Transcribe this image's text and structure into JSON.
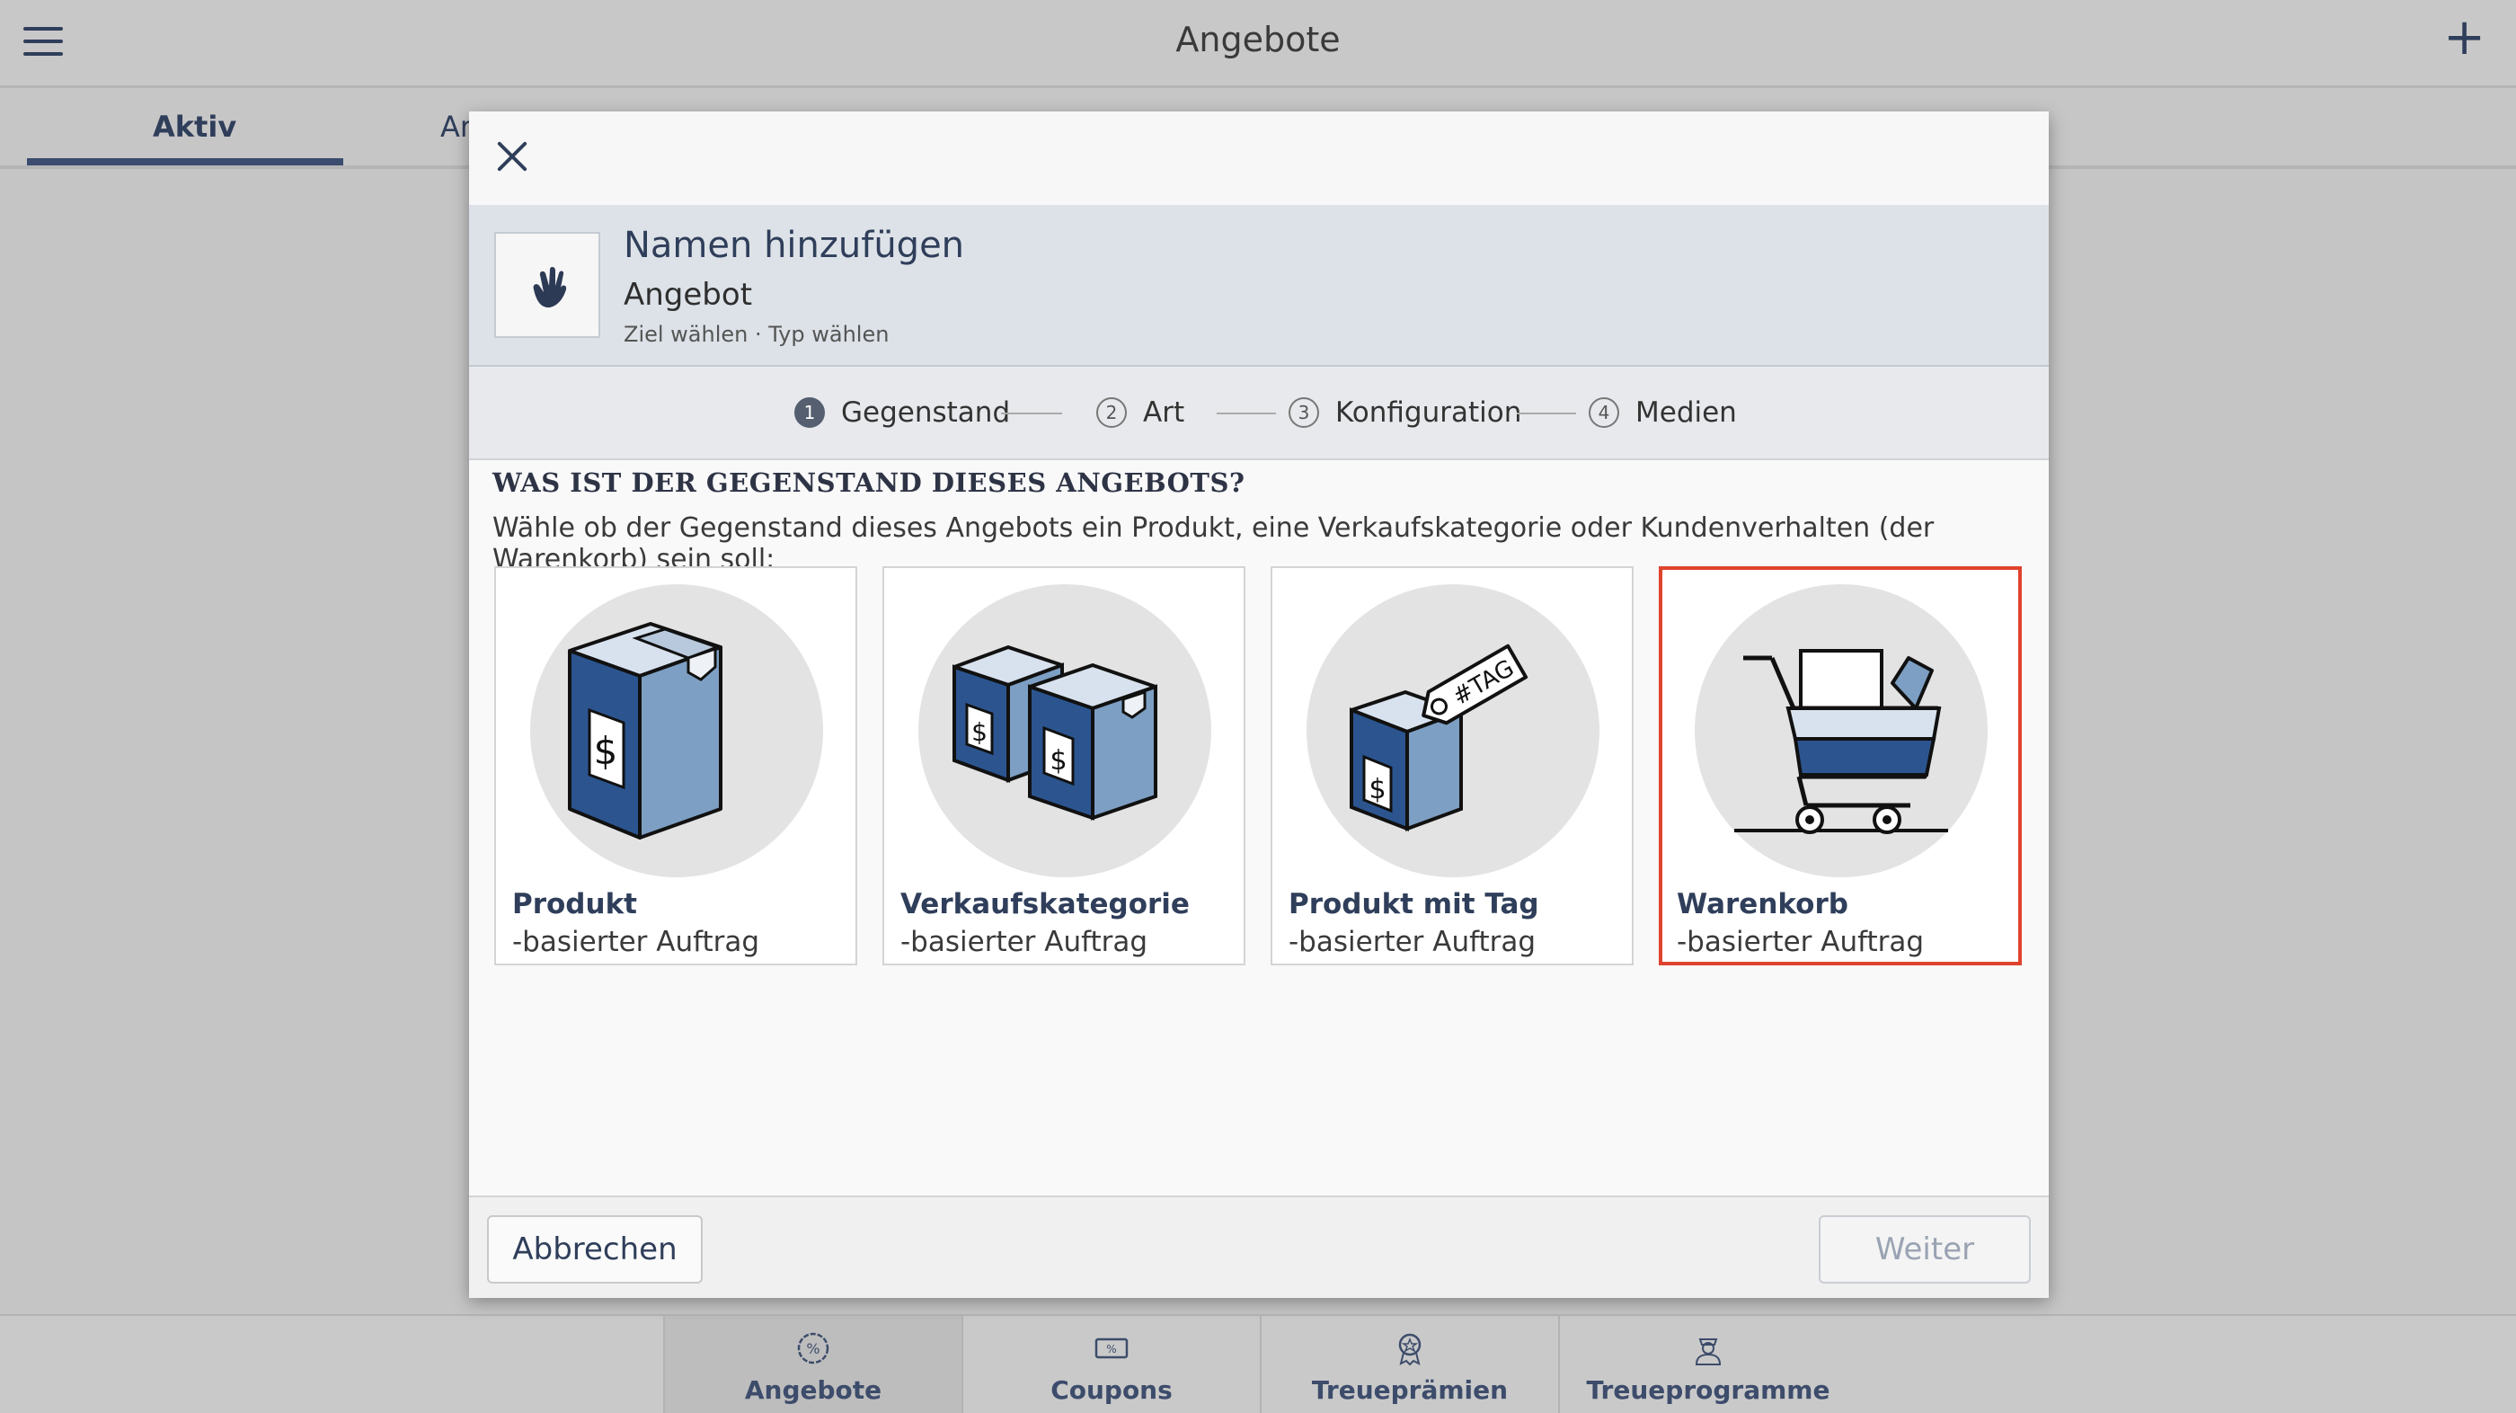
{
  "app": {
    "title": "Angebote",
    "tabs": [
      "Aktiv",
      "Ar"
    ]
  },
  "bottom_nav": [
    {
      "label": "Angebote",
      "icon": "percent-badge-icon"
    },
    {
      "label": "Coupons",
      "icon": "coupon-icon"
    },
    {
      "label": "Treueprämien",
      "icon": "award-icon"
    },
    {
      "label": "Treueprogramme",
      "icon": "person-badge-icon"
    }
  ],
  "modal": {
    "header": {
      "title": "Namen hinzufügen",
      "subtitle": "Angebot",
      "breadcrumb": "Ziel wählen · Typ wählen"
    },
    "steps": [
      {
        "num": "1",
        "label": "Gegenstand",
        "active": true
      },
      {
        "num": "2",
        "label": "Art",
        "active": false
      },
      {
        "num": "3",
        "label": "Konfiguration",
        "active": false
      },
      {
        "num": "4",
        "label": "Medien",
        "active": false
      }
    ],
    "question": "WAS IST DER GEGENSTAND DIESES ANGEBOTS?",
    "instruction": "Wähle ob der Gegenstand dieses Angebots ein Produkt, eine Verkaufskategorie oder Kundenverhalten (der Warenkorb) sein soll:",
    "options": [
      {
        "title": "Produkt",
        "subtitle": "-basierter Auftrag",
        "icon": "product-box-icon",
        "selected": false
      },
      {
        "title": "Verkaufskategorie",
        "subtitle": "-basierter Auftrag",
        "icon": "category-boxes-icon",
        "selected": false
      },
      {
        "title": "Produkt mit Tag",
        "subtitle": "-basierter Auftrag",
        "icon": "tagged-product-icon",
        "tag_text": "#TAG",
        "selected": false
      },
      {
        "title": "Warenkorb",
        "subtitle": "-basierter Auftrag",
        "icon": "shopping-cart-icon",
        "selected": true
      }
    ],
    "buttons": {
      "cancel": "Abbrechen",
      "next": "Weiter"
    }
  },
  "colors": {
    "accent": "#2f3e5a",
    "box_dark": "#2c5590",
    "box_light": "#7d9fc3",
    "selection": "#e0432d"
  }
}
